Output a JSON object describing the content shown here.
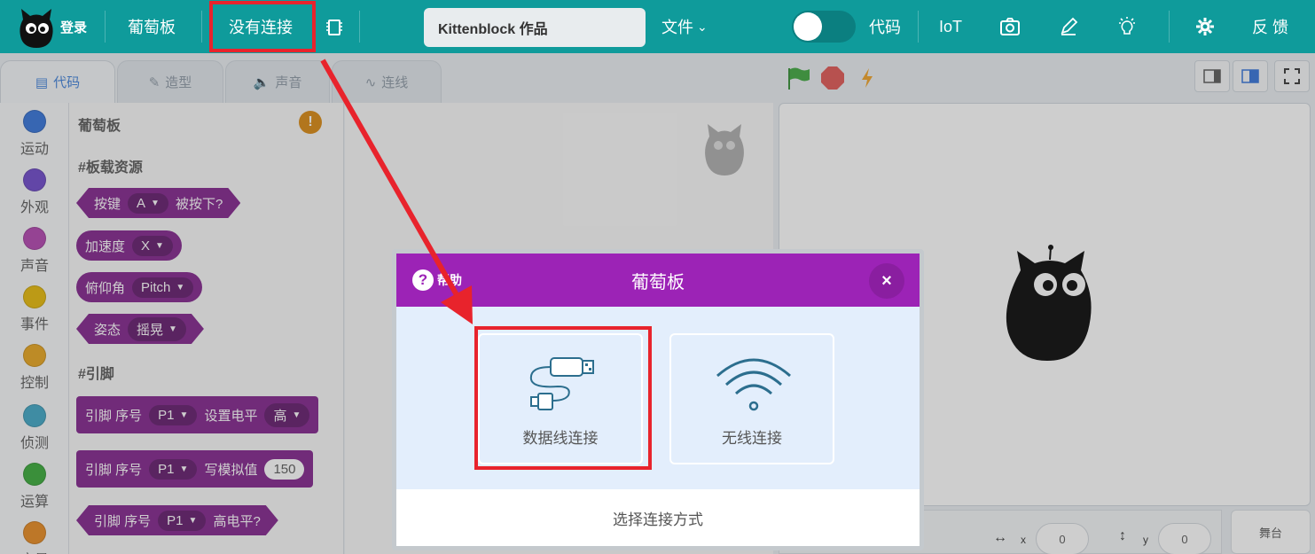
{
  "topbar": {
    "login": "登录",
    "device": "葡萄板",
    "connection": "没有连接",
    "project_title": "Kittenblock 作品",
    "file_menu": "文件",
    "code_toggle_label": "代码",
    "iot": "IoT",
    "feedback": "反 馈"
  },
  "tabs": {
    "code": "代码",
    "costume": "造型",
    "sound": "声音",
    "connect": "连线"
  },
  "categories": [
    {
      "label": "运动",
      "color": "#2f6fd8"
    },
    {
      "label": "外观",
      "color": "#6a43c9"
    },
    {
      "label": "声音",
      "color": "#b13fae"
    },
    {
      "label": "事件",
      "color": "#e6b800"
    },
    {
      "label": "控制",
      "color": "#e8a317"
    },
    {
      "label": "侦测",
      "color": "#3aa4c4"
    },
    {
      "label": "运算",
      "color": "#33a833"
    },
    {
      "label": "变量",
      "color": "#e8871a"
    }
  ],
  "palette": {
    "title": "葡萄板",
    "section_board": "#板载资源",
    "section_pins": "#引脚",
    "block_button": {
      "label": "按键",
      "option": "A",
      "suffix": "被按下?"
    },
    "block_accel": {
      "label": "加速度",
      "option": "X"
    },
    "block_pitch": {
      "label": "俯仰角",
      "option": "Pitch"
    },
    "block_posture": {
      "label": "姿态",
      "option": "摇晃"
    },
    "block_set_level": {
      "label": "引脚 序号",
      "pin": "P1",
      "action": "设置电平",
      "level": "高"
    },
    "block_analog": {
      "label": "引脚 序号",
      "pin": "P1",
      "action": "写模拟值",
      "value": "150"
    },
    "block_high": {
      "label": "引脚 序号",
      "pin": "P1",
      "action": "高电平?"
    }
  },
  "stage": {
    "x_label": "x",
    "x_value": "0",
    "y_label": "y",
    "y_value": "0",
    "stage_button": "舞台"
  },
  "modal": {
    "help": "帮助",
    "title": "葡萄板",
    "close": "×",
    "option_cable": "数据线连接",
    "option_wireless": "无线连接",
    "footer": "选择连接方式"
  },
  "accent": {
    "topbar": "#0f9b9b",
    "modal_header": "#9c23b6",
    "highlight": "#e8232c",
    "block": "#7e1e8a"
  }
}
